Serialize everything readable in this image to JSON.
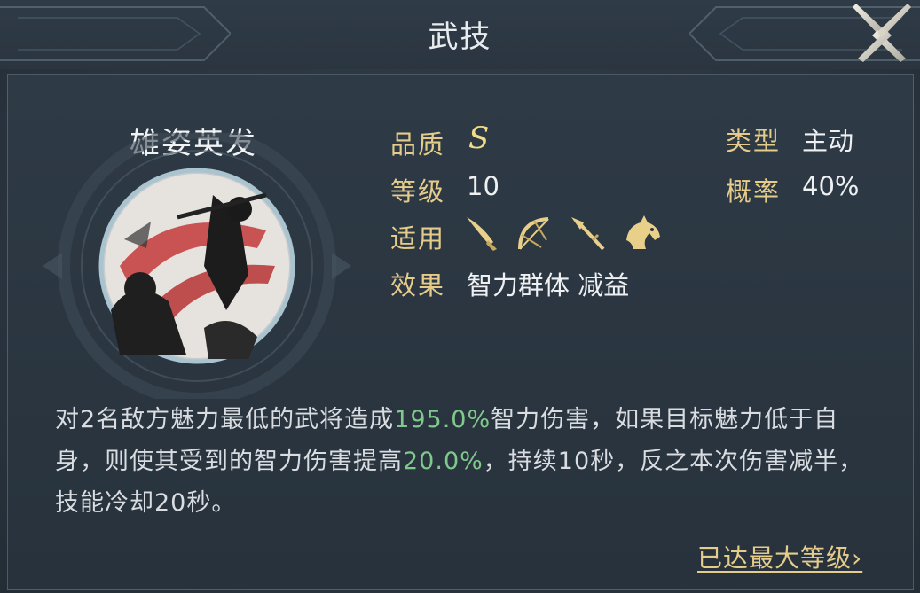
{
  "window": {
    "title": "武技"
  },
  "skill": {
    "name": "雄姿英发",
    "labels": {
      "quality": "品质",
      "level": "等级",
      "applicable": "适用",
      "effect": "效果",
      "type": "类型",
      "chance": "概率"
    },
    "quality": "S",
    "level": "10",
    "applicable_icons": [
      "sword-icon",
      "bow-icon",
      "spear-icon",
      "horse-icon"
    ],
    "effect": "智力群体 减益",
    "type": "主动",
    "chance": "40%"
  },
  "description": {
    "p1": "对2名敌方魅力最低的武将造成",
    "v1": "195.0%",
    "p2": "智力伤害，如果目标魅力低于自身，则使其受到的智力伤害提高",
    "v2": "20.0%",
    "p3": "，持续10秒，反之本次伤害减半，技能冷却20秒。"
  },
  "footer": {
    "max_level_link": "已达最大等级",
    "chevron": "›"
  },
  "colors": {
    "label_gold": "#e5cc8a",
    "highlight_green": "#7fc98c",
    "text": "#eef0f2"
  }
}
